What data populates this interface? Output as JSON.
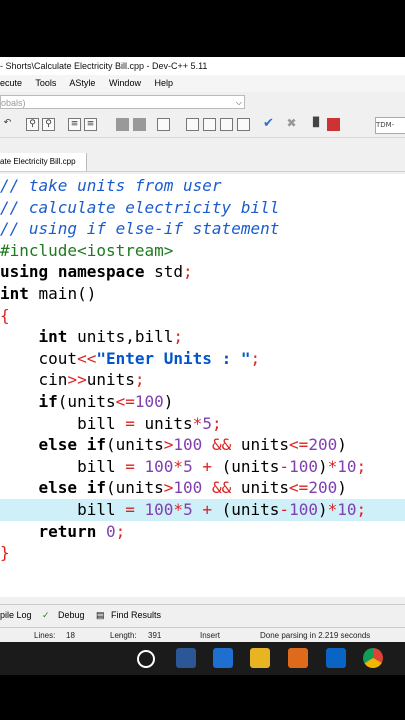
{
  "window": {
    "title": "- Shorts\\Calculate Electricity Bill.cpp - Dev-C++ 5.11"
  },
  "menu": [
    "ecute",
    "Tools",
    "AStyle",
    "Window",
    "Help"
  ],
  "scope_combo": {
    "value": "obals)"
  },
  "toolbar": {
    "right_label": "TDM-"
  },
  "editor_tab": {
    "label": "ate Electricity Bill.cpp"
  },
  "code": [
    "// take units from user",
    "// calculate electricity bill",
    "// using if else-if statement",
    "#include<iostream>",
    "using namespace std;",
    "int main()",
    "{",
    "    int units,bill;",
    "    cout<<\"Enter Units : \";",
    "    cin>>units;",
    "    if(units<=100)",
    "        bill = units*5;",
    "    else if(units>100 && units<=200)",
    "        bill = 100*5 + (units-100)*10;",
    "    else if(units>100 && units<=200)",
    "        bill = 100*5 + (units-100)*10;",
    "    return 0;",
    "}"
  ],
  "highlighted_line": 15,
  "bottom_tabs": {
    "compile_log": "pile Log",
    "debug": "Debug",
    "find_results": "Find Results"
  },
  "status": {
    "lines_label": "Lines:",
    "lines_value": "18",
    "length_label": "Length:",
    "length_value": "391",
    "mode": "Insert",
    "message": "Done parsing in 2.219 seconds"
  }
}
